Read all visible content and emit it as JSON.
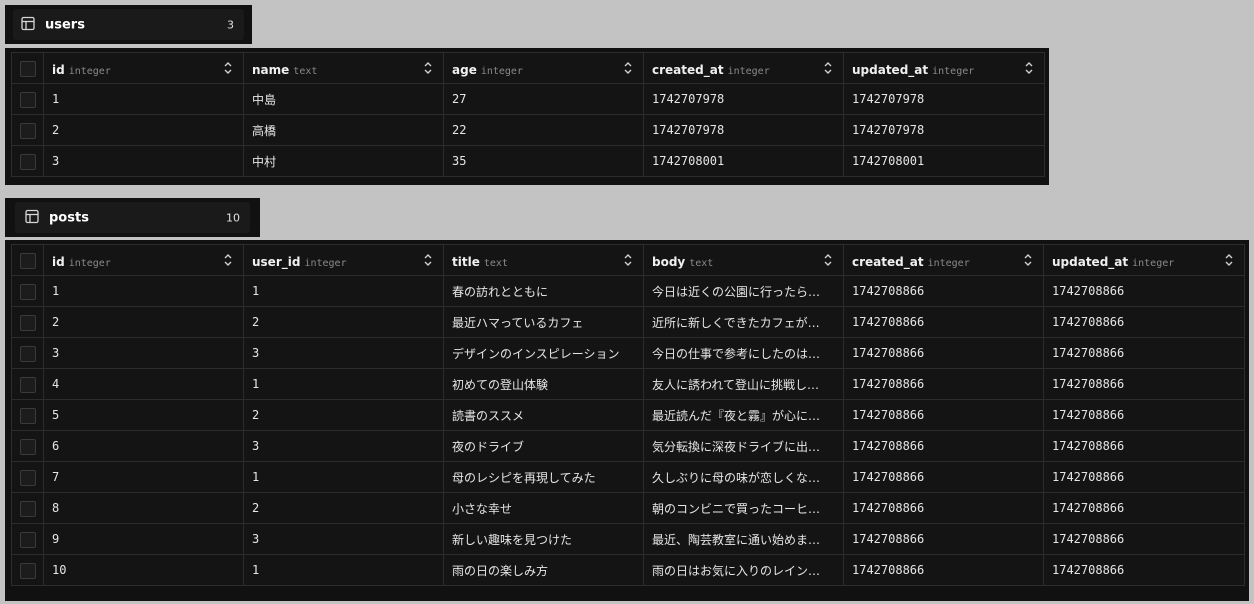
{
  "tables": [
    {
      "name": "users",
      "row_count": "3",
      "columns": [
        {
          "name": "id",
          "type": "integer"
        },
        {
          "name": "name",
          "type": "text"
        },
        {
          "name": "age",
          "type": "integer"
        },
        {
          "name": "created_at",
          "type": "integer"
        },
        {
          "name": "updated_at",
          "type": "integer"
        }
      ],
      "rows": [
        [
          "1",
          "中島",
          "27",
          "1742707978",
          "1742707978"
        ],
        [
          "2",
          "高橋",
          "22",
          "1742707978",
          "1742707978"
        ],
        [
          "3",
          "中村",
          "35",
          "1742708001",
          "1742708001"
        ]
      ]
    },
    {
      "name": "posts",
      "row_count": "10",
      "columns": [
        {
          "name": "id",
          "type": "integer"
        },
        {
          "name": "user_id",
          "type": "integer"
        },
        {
          "name": "title",
          "type": "text"
        },
        {
          "name": "body",
          "type": "text"
        },
        {
          "name": "created_at",
          "type": "integer"
        },
        {
          "name": "updated_at",
          "type": "integer"
        }
      ],
      "rows": [
        [
          "1",
          "1",
          "春の訪れとともに",
          "今日は近くの公園に行ったら…",
          "1742708866",
          "1742708866"
        ],
        [
          "2",
          "2",
          "最近ハマっているカフェ",
          "近所に新しくできたカフェが…",
          "1742708866",
          "1742708866"
        ],
        [
          "3",
          "3",
          "デザインのインスピレーション",
          "今日の仕事で参考にしたのは…",
          "1742708866",
          "1742708866"
        ],
        [
          "4",
          "1",
          "初めての登山体験",
          "友人に誘われて登山に挑戦し…",
          "1742708866",
          "1742708866"
        ],
        [
          "5",
          "2",
          "読書のススメ",
          "最近読んだ『夜と霧』が心に…",
          "1742708866",
          "1742708866"
        ],
        [
          "6",
          "3",
          "夜のドライブ",
          "気分転換に深夜ドライブに出…",
          "1742708866",
          "1742708866"
        ],
        [
          "7",
          "1",
          "母のレシピを再現してみた",
          "久しぶりに母の味が恋しくな…",
          "1742708866",
          "1742708866"
        ],
        [
          "8",
          "2",
          "小さな幸せ",
          "朝のコンビニで買ったコーヒ…",
          "1742708866",
          "1742708866"
        ],
        [
          "9",
          "3",
          "新しい趣味を見つけた",
          "最近、陶芸教室に通い始めま…",
          "1742708866",
          "1742708866"
        ],
        [
          "10",
          "1",
          "雨の日の楽しみ方",
          "雨の日はお気に入りのレイン…",
          "1742708866",
          "1742708866"
        ]
      ]
    }
  ],
  "icons": {
    "table": "table-icon",
    "sort": "sort-icon",
    "checkbox": "checkbox"
  },
  "colors": {
    "background": "#c3c3c3",
    "panel": "#111111",
    "grid": "#141414",
    "border": "#2c2c2c",
    "text": "#e6e6e6",
    "type_text": "#8a8a8a"
  }
}
